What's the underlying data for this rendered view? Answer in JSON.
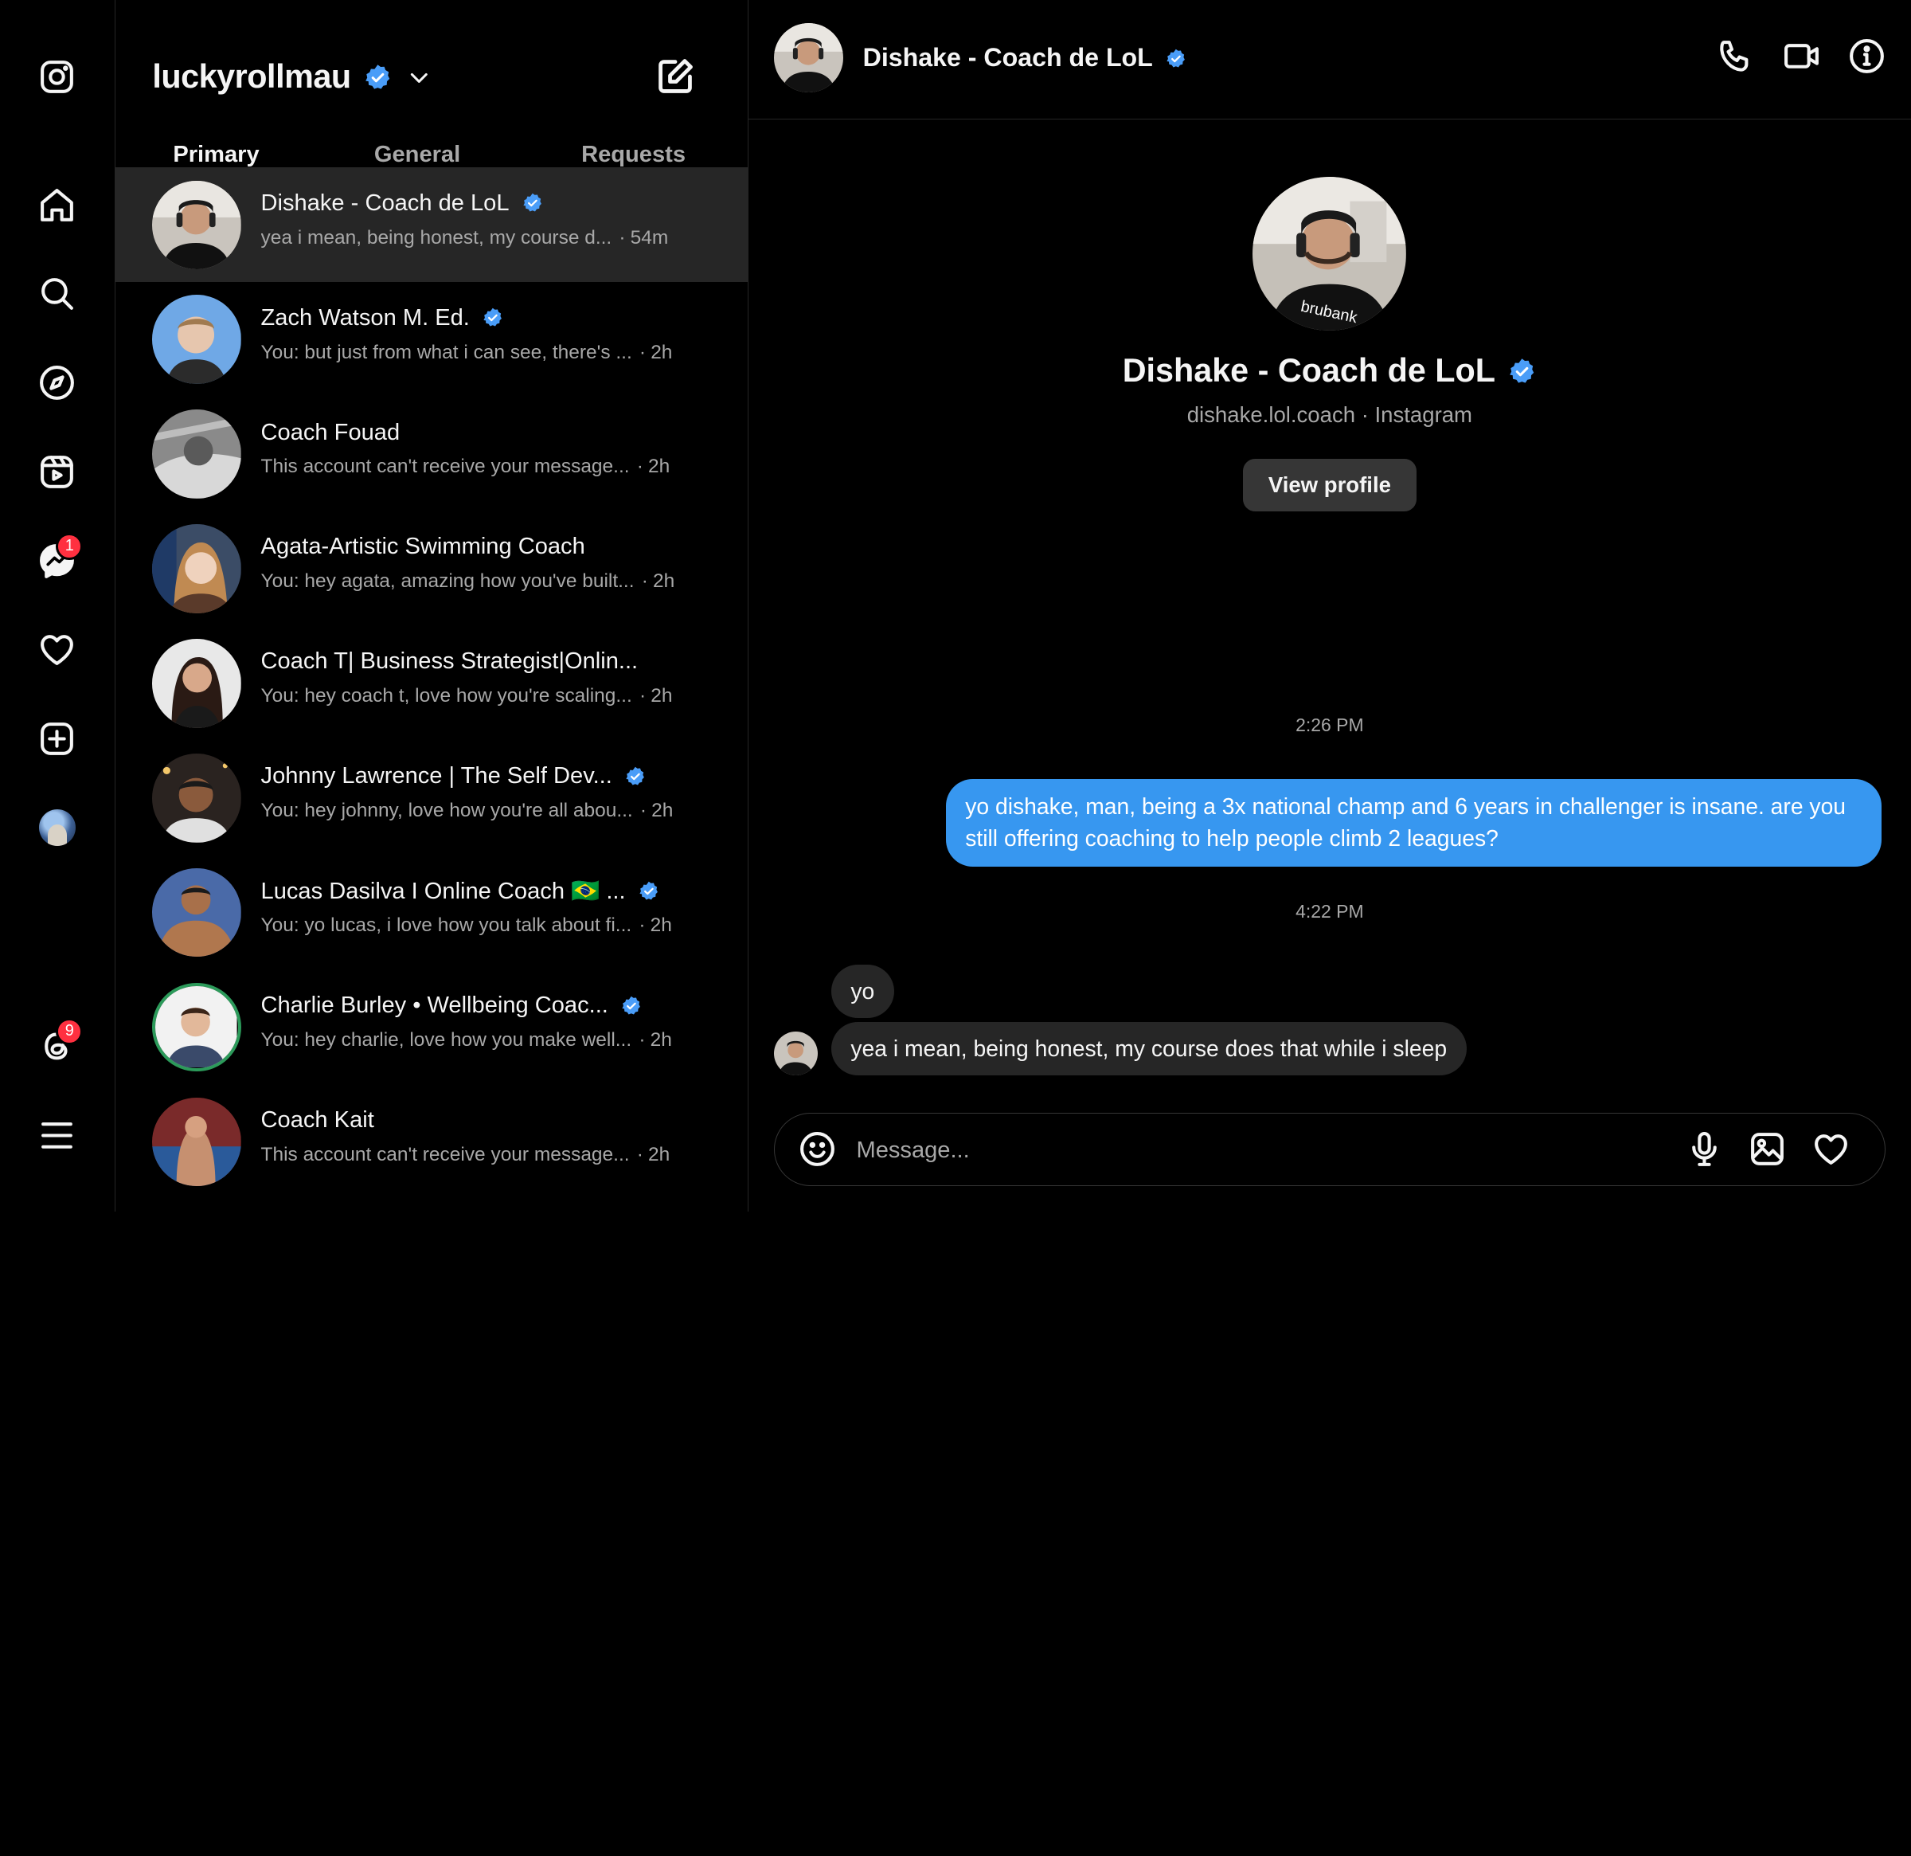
{
  "rail": {
    "items": [
      {
        "name": "instagram-logo-icon"
      },
      {
        "name": "home-icon"
      },
      {
        "name": "search-icon"
      },
      {
        "name": "explore-icon"
      },
      {
        "name": "reels-icon"
      },
      {
        "name": "messages-icon",
        "badge": "1"
      },
      {
        "name": "heart-icon"
      },
      {
        "name": "create-icon"
      },
      {
        "name": "profile-avatar"
      },
      {
        "name": "threads-icon",
        "badge": "9"
      },
      {
        "name": "menu-icon"
      }
    ]
  },
  "inbox": {
    "account": "luckyrollmau",
    "tabs": [
      "Primary",
      "General",
      "Requests"
    ],
    "active_tab": "Primary",
    "threads": [
      {
        "name": "Dishake - Coach de LoL",
        "verified": true,
        "preview": "yea i mean, being honest, my course d...",
        "time": "54m",
        "active": true
      },
      {
        "name": "Zach Watson M. Ed.",
        "verified": true,
        "preview": "You: but just from what i can see, there's ...",
        "time": "2h"
      },
      {
        "name": "Coach Fouad",
        "verified": false,
        "preview": "This account can't receive your message...",
        "time": "2h"
      },
      {
        "name": "Agata-Artistic Swimming Coach",
        "verified": false,
        "preview": "You: hey agata, amazing how you've built...",
        "time": "2h"
      },
      {
        "name": "Coach T| Business Strategist|Onlin...",
        "verified": false,
        "preview": "You: hey coach t, love how you're scaling...",
        "time": "2h"
      },
      {
        "name": "Johnny Lawrence | The Self Dev...",
        "verified": true,
        "preview": "You: hey johnny, love how you're all abou...",
        "time": "2h"
      },
      {
        "name": "Lucas Dasilva I Online Coach 🇧🇷 ...",
        "verified": true,
        "preview": "You: yo lucas, i love how you talk about fi...",
        "time": "2h"
      },
      {
        "name": "Charlie Burley • Wellbeing Coac...",
        "verified": true,
        "preview": "You: hey charlie, love how you make well...",
        "time": "2h"
      },
      {
        "name": "Coach Kait",
        "verified": false,
        "preview": "This account can't receive your message...",
        "time": "2h"
      }
    ]
  },
  "chat": {
    "header_name": "Dishake - Coach de LoL",
    "profile_name": "Dishake - Coach de LoL",
    "profile_sub": "dishake.lol.coach · Instagram",
    "view_profile_label": "View profile",
    "time_1": "2:26 PM",
    "outgoing_message": "yo dishake, man, being a 3x national champ and 6 years in challenger is insane. are you still offering coaching to help people climb 2 leagues?",
    "time_2": "4:22 PM",
    "incoming_1": "yo",
    "incoming_2": "yea i mean, being honest, my course does that while i sleep",
    "composer_placeholder": "Message..."
  },
  "colors": {
    "accent": "#3797f0",
    "verified": "#4a9df8",
    "badge": "#ff3040",
    "bg": "#000000",
    "surface": "#262626"
  }
}
